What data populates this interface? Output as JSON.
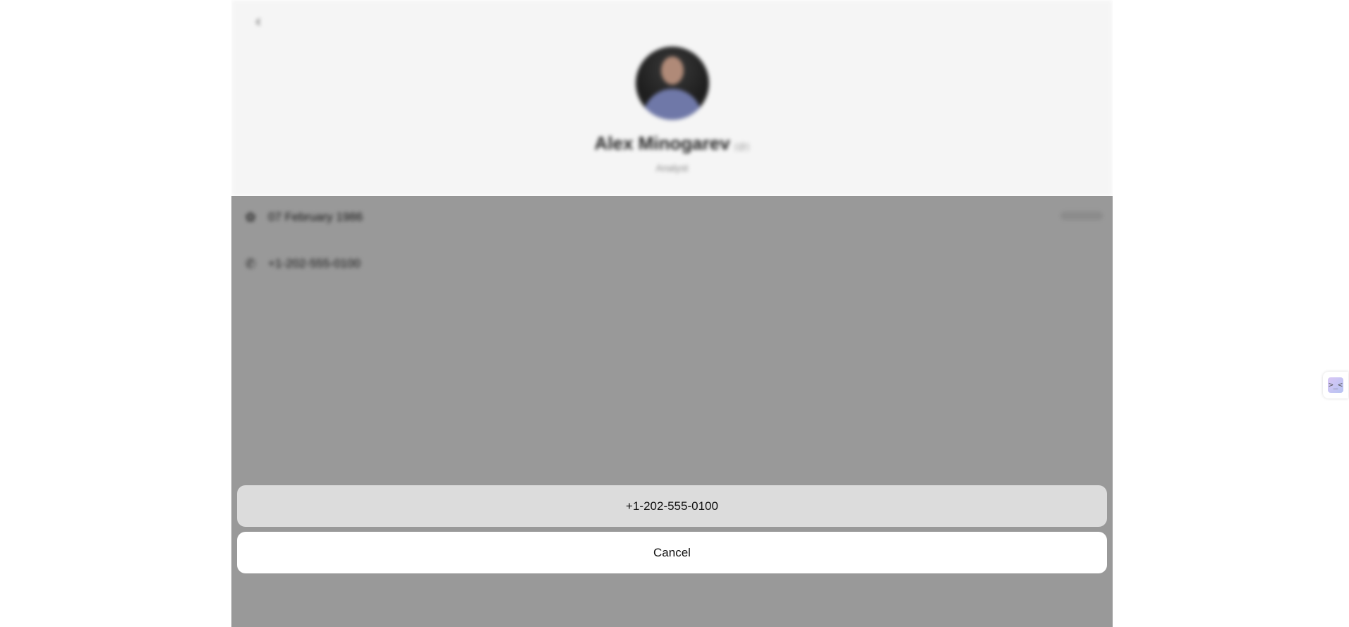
{
  "profile": {
    "name": "Alex Minogarev",
    "pronoun": "(@)",
    "role": "Analyst",
    "avatar_icon": "user-photo",
    "back_icon": "chevron-left-icon"
  },
  "details": {
    "birthday": "07 February 1986",
    "birthday_icon": "gift-icon",
    "phone": "+1-202-555-0100",
    "phone_icon": "phone-icon",
    "edit_label": ""
  },
  "action_sheet": {
    "call_option": "+1-202-555-0100",
    "cancel_label": "Cancel"
  },
  "side_widget": {
    "glyph": ">_<",
    "icon": "assistant-icon"
  },
  "colors": {
    "header_bg": "#f5f5f5",
    "overlay": "rgba(0,0,0,0.40)",
    "option_bg": "#dcdcdc",
    "cancel_bg": "#ffffff"
  }
}
